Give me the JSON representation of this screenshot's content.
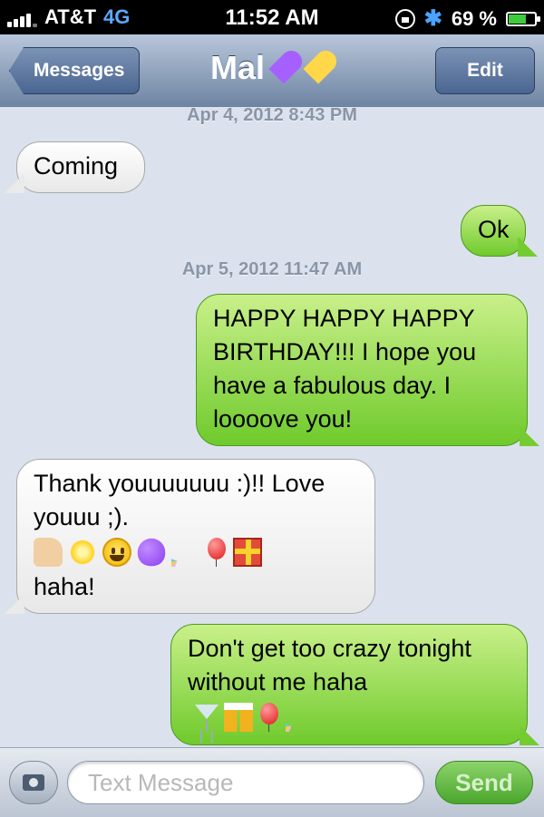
{
  "status_bar": {
    "carrier": "AT&T",
    "network": "4G",
    "time": "11:52 AM",
    "battery_percent_text": "69 %",
    "battery_level": 0.69,
    "icons": [
      "signal-icon",
      "rotation-lock-icon",
      "bluetooth-icon",
      "battery-icon"
    ]
  },
  "nav": {
    "back_label": "Messages",
    "title": "Mal",
    "title_emoji": [
      "purple-heart-icon",
      "yellow-heart-icon"
    ],
    "edit_label": "Edit",
    "heart_colors": [
      "#a660ff",
      "#ffd84a"
    ]
  },
  "thread": {
    "timestamps": [
      "Apr 4, 2012 8:43 PM",
      "Apr 5, 2012 11:47 AM"
    ],
    "messages": [
      {
        "from": "them",
        "text": "Coming"
      },
      {
        "from": "me",
        "text": "Ok"
      },
      {
        "from": "me",
        "text": "HAPPY HAPPY HAPPY BIRTHDAY!!! I hope you have a fabulous day. I loooove you!"
      },
      {
        "from": "them",
        "text": "Thank youuuuuuu :)!! Love youuu ;).",
        "emoji": [
          "thumbs-up-icon",
          "sparkle-star-icon",
          "smiley-icon",
          "purple-heart-icon",
          "party-popper-icon",
          "balloon-icon",
          "gift-icon"
        ],
        "text_after": "haha!"
      },
      {
        "from": "me",
        "text": "Don't get too crazy tonight without me haha",
        "emoji": [
          "cocktail-icon",
          "beers-icon",
          "balloon-icon",
          "party-popper-icon"
        ]
      }
    ]
  },
  "input": {
    "placeholder": "Text Message",
    "send_label": "Send"
  },
  "colors": {
    "outgoing_bubble": "#7fd13a",
    "incoming_bubble": "#f2f2f2",
    "nav_bar": "#8197b5",
    "background": "#dbe2ed"
  }
}
